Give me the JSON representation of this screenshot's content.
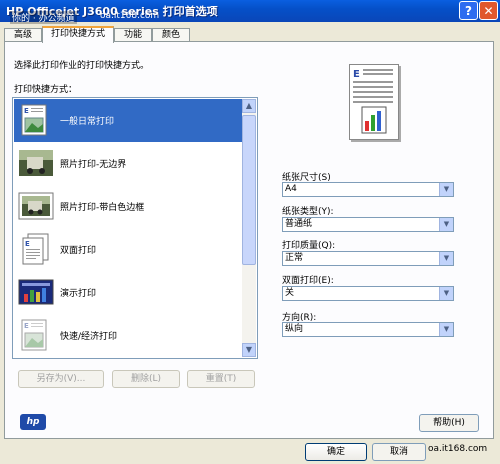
{
  "window": {
    "title": "HP Officejet J3600 series 打印首选项",
    "watermark_left": "你的 · 办公频道",
    "watermark_right": "oa.it168.com"
  },
  "tabs": [
    {
      "label": "高级"
    },
    {
      "label": "打印快捷方式"
    },
    {
      "label": "功能"
    },
    {
      "label": "颜色"
    }
  ],
  "main": {
    "instruction": "选择此打印作业的打印快捷方式。",
    "list_label": "打印快捷方式：",
    "shortcuts": [
      {
        "label": "一般日常打印",
        "icon": "document-icon"
      },
      {
        "label": "照片打印-无边界",
        "icon": "photo-borderless-icon"
      },
      {
        "label": "照片打印-带白色边框",
        "icon": "photo-white-border-icon"
      },
      {
        "label": "双面打印",
        "icon": "two-sided-icon"
      },
      {
        "label": "演示打印",
        "icon": "presentation-icon"
      },
      {
        "label": "快速/经济打印",
        "icon": "fast-economy-icon"
      }
    ],
    "selected_index": 0,
    "buttons": {
      "save_as": "另存为(V)...",
      "delete": "删除(L)",
      "reset": "重置(T)"
    }
  },
  "settings": {
    "paper_size_label": "纸张尺寸(S)",
    "paper_size_value": "A4",
    "paper_type_label": "纸张类型(Y):",
    "paper_type_value": "普通纸",
    "print_quality_label": "打印质量(Q):",
    "print_quality_value": "正常",
    "duplex_label": "双面打印(E):",
    "duplex_value": "关",
    "orientation_label": "方向(R):",
    "orientation_value": "纵向"
  },
  "footer": {
    "help_button": "帮助(H)",
    "ok_button": "确定",
    "cancel_button": "取消",
    "brand": "hp",
    "watermark_left": "你的 · 办公频道",
    "watermark_right": "oa.it168.com"
  },
  "colors": {
    "titlebar": "#0550c8",
    "selection": "#316ac5",
    "dialog_bg": "#ece9d8"
  }
}
